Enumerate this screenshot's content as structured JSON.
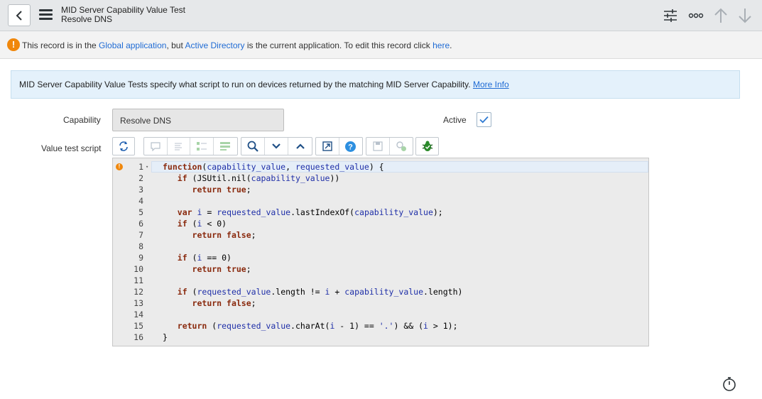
{
  "header": {
    "title": "MID Server Capability Value Test",
    "subtitle": "Resolve DNS",
    "icons": [
      "back-icon",
      "menu-icon",
      "settings-sliders-icon",
      "more-icon",
      "arrow-up-icon",
      "arrow-down-icon"
    ]
  },
  "notice": {
    "t1": "This record is in the ",
    "l1": "Global application",
    "t2": ", but ",
    "l2": "Active Directory",
    "t3": " is the current application. To edit this record click ",
    "l3": "here",
    "t4": "."
  },
  "info": {
    "text": "MID Server Capability Value Tests specify what script to run on devices returned by the matching MID Server Capability.",
    "more_info": "More Info"
  },
  "form": {
    "capability_label": "Capability",
    "capability_value": "Resolve DNS",
    "active_label": "Active",
    "active_checked": true,
    "script_label": "Value test script"
  },
  "editor": {
    "line_numbers": [
      "1",
      "2",
      "3",
      "4",
      "5",
      "6",
      "7",
      "8",
      "9",
      "10",
      "11",
      "12",
      "13",
      "14",
      "15",
      "16"
    ],
    "fold_marker": "▾",
    "warn_mark": "!"
  },
  "colors": {
    "accent": "#1f6bd4",
    "warning": "#f0870b",
    "header_bg": "#e6e8ea",
    "info_bg": "#e4f1fb"
  }
}
